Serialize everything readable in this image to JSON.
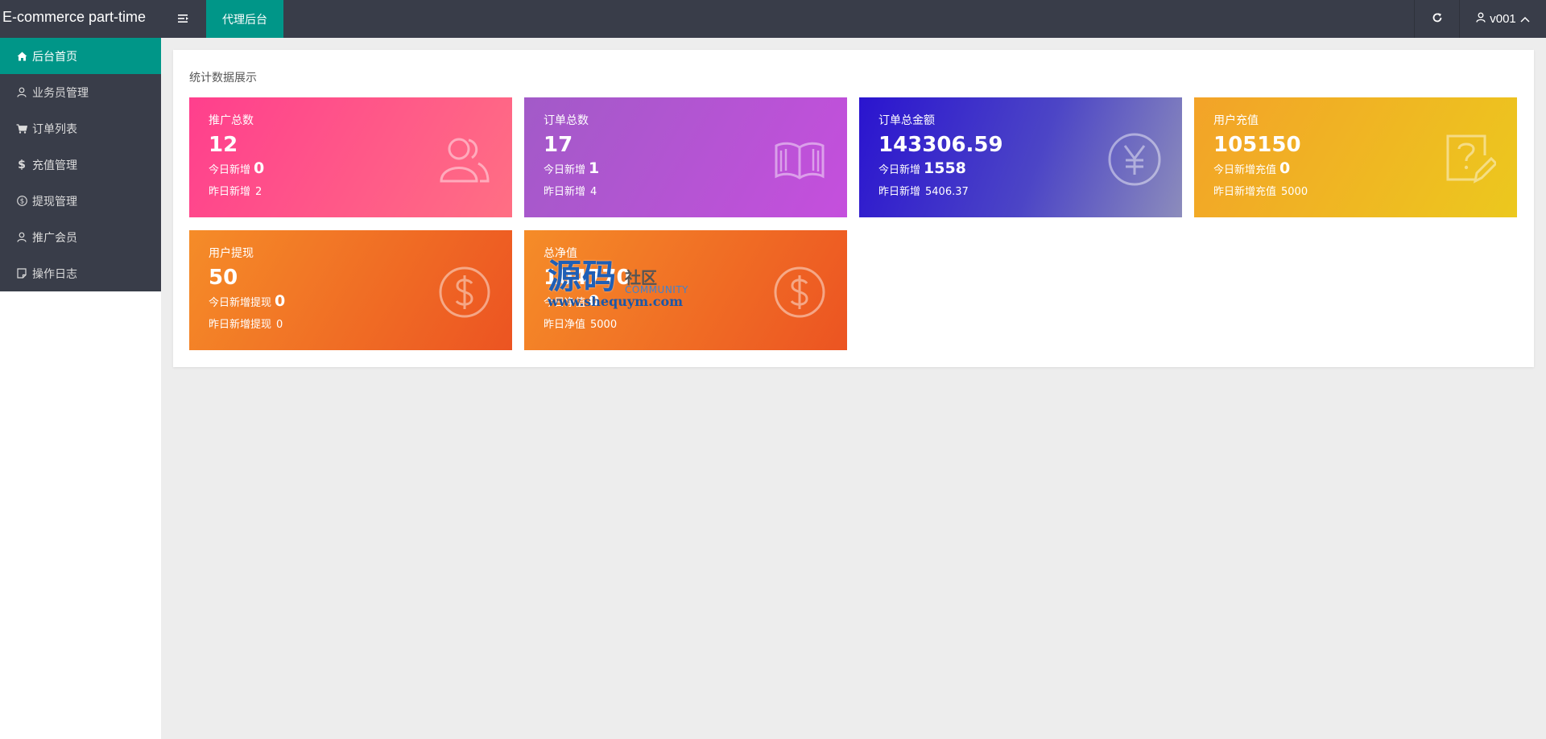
{
  "header": {
    "brand": "E-commerce part-time",
    "tab": "代理后台",
    "user": "v001",
    "icons": {
      "menu_toggle": "menu-toggle-icon",
      "refresh": "refresh-icon",
      "user": "user-icon",
      "chevron": "chevron-up-icon"
    }
  },
  "sidebar": {
    "items": [
      {
        "label": "后台首页",
        "icon": "home-icon",
        "active": true
      },
      {
        "label": "业务员管理",
        "icon": "user-icon"
      },
      {
        "label": "订单列表",
        "icon": "cart-icon"
      },
      {
        "label": "充值管理",
        "icon": "dollar-icon"
      },
      {
        "label": "提现管理",
        "icon": "dollar-circle-icon"
      },
      {
        "label": "推广会员",
        "icon": "user-icon"
      },
      {
        "label": "操作日志",
        "icon": "note-icon"
      }
    ]
  },
  "main": {
    "panel_title": "统计数据展示",
    "cards": [
      {
        "title": "推广总数",
        "value": "12",
        "today_label": "今日新增",
        "today_value": "0",
        "yesterday_label": "昨日新增",
        "yesterday_value": "2",
        "icon": "users-icon",
        "color": "#ff4f8a"
      },
      {
        "title": "订单总数",
        "value": "17",
        "today_label": "今日新增",
        "today_value": "1",
        "yesterday_label": "昨日新增",
        "yesterday_value": "4",
        "icon": "book-icon",
        "color": "#b455d4"
      },
      {
        "title": "订单总金额",
        "value": "143306.59",
        "today_label": "今日新增",
        "today_value": "1558",
        "yesterday_label": "昨日新增",
        "yesterday_value": "5406.37",
        "icon": "yen-circle-icon",
        "color": "#3a2ccc"
      },
      {
        "title": "用户充值",
        "value": "105150",
        "today_label": "今日新增充值",
        "today_value": "0",
        "yesterday_label": "昨日新增充值",
        "yesterday_value": "5000",
        "icon": "question-edit-icon",
        "color": "#f0b424"
      },
      {
        "title": "用户提现",
        "value": "50",
        "today_label": "今日新增提现",
        "today_value": "0",
        "yesterday_label": "昨日新增提现",
        "yesterday_value": "0",
        "icon": "dollar-circle-icon",
        "color": "#f07026"
      },
      {
        "title": "总净值",
        "value": "104770",
        "today_label": "今日净值",
        "today_value": "0",
        "yesterday_label": "昨日净值",
        "yesterday_value": "5000",
        "icon": "dollar-circle-icon",
        "color": "#f07026"
      }
    ]
  },
  "watermark": {
    "main": "源码",
    "side": "社区",
    "community": "COMMUNITY",
    "url": "www.shequym.com"
  }
}
